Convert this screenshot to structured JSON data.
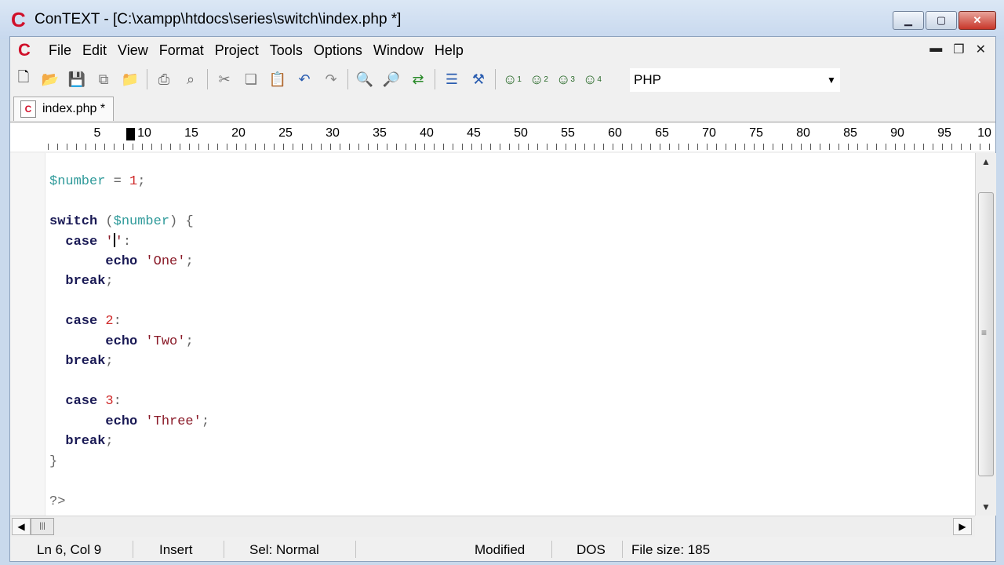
{
  "window": {
    "title": "ConTEXT - [C:\\xampp\\htdocs\\series\\switch\\index.php *]",
    "logo_letter": "C"
  },
  "menubar": {
    "items": [
      "File",
      "Edit",
      "View",
      "Format",
      "Project",
      "Tools",
      "Options",
      "Window",
      "Help"
    ]
  },
  "toolbar": {
    "language": "PHP",
    "icons": [
      "new-file-icon",
      "open-folder-icon",
      "save-icon",
      "save-all-icon",
      "open-project-icon",
      "print-icon",
      "print-preview-icon",
      "cut-icon",
      "copy-icon",
      "paste-icon",
      "undo-icon",
      "redo-icon",
      "find-icon",
      "find-next-icon",
      "replace-icon",
      "export-icon",
      "tools-icon",
      "user-command-1-icon",
      "user-command-2-icon",
      "user-command-3-icon",
      "user-command-4-icon"
    ]
  },
  "tabs": [
    {
      "label": "index.php *"
    }
  ],
  "ruler": {
    "labels": [
      "5",
      "10",
      "15",
      "20",
      "25",
      "30",
      "35",
      "40",
      "45",
      "50",
      "55",
      "60",
      "65",
      "70",
      "75",
      "80",
      "85",
      "90",
      "95",
      "10"
    ]
  },
  "editor": {
    "lines": {
      "l1_var": "$number",
      "l1_op": " = ",
      "l1_num": "1",
      "l1_end": ";",
      "l2_kw": "switch",
      "l2_open": " (",
      "l2_var": "$number",
      "l2_close": ") {",
      "l3_kw": "  case",
      "l3_str_open": " '",
      "l3_str_close": "'",
      "l3_end": ":",
      "l4_kw": "       echo",
      "l4_str": " 'One'",
      "l4_end": ";",
      "l5_kw": "  break",
      "l5_end": ";",
      "l6_kw": "  case",
      "l6_num": " 2",
      "l6_end": ":",
      "l7_kw": "       echo",
      "l7_str": " 'Two'",
      "l7_end": ";",
      "l8_kw": "  break",
      "l8_end": ";",
      "l9_kw": "  case",
      "l9_num": " 3",
      "l9_end": ":",
      "l10_kw": "       echo",
      "l10_str": " 'Three'",
      "l10_end": ";",
      "l11_kw": "  break",
      "l11_end": ";",
      "l12": "}",
      "l13": "?>"
    }
  },
  "statusbar": {
    "position": "Ln 6, Col 9",
    "mode": "Insert",
    "selection": "Sel: Normal",
    "modified": "Modified",
    "line_endings": "DOS",
    "file_size": "File size: 185"
  },
  "colors": {
    "accent": "#d0102a",
    "keyword": "#1a1a55",
    "variable": "#2f9a9a",
    "number": "#cf2b2b",
    "string": "#8a1a28"
  }
}
